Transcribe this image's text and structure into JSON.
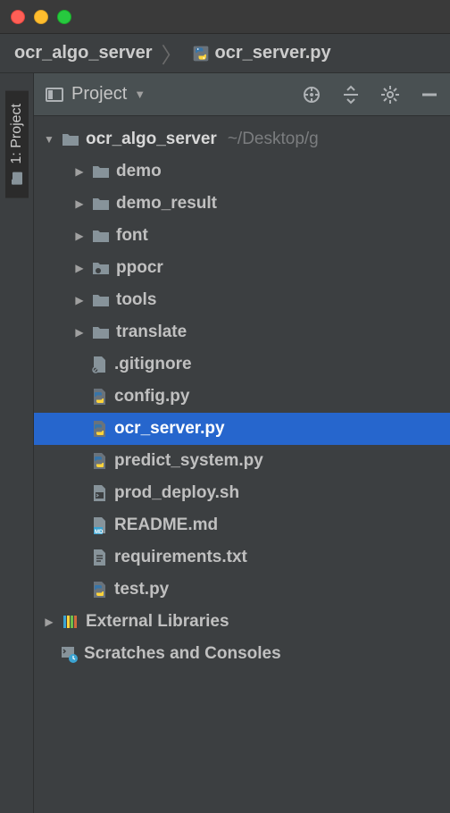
{
  "breadcrumb": {
    "root": "ocr_algo_server",
    "file": "ocr_server.py"
  },
  "rail": {
    "project_tab": "1: Project"
  },
  "panel": {
    "title_icon": "project-view-icon",
    "title": "Project",
    "icons": {
      "target": "select-opened-file",
      "collapse": "expand-all",
      "settings": "settings",
      "hide": "hide"
    }
  },
  "tree": {
    "root": {
      "name": "ocr_algo_server",
      "path_hint": "~/Desktop/g",
      "children": [
        {
          "type": "folder",
          "name": "demo"
        },
        {
          "type": "folder",
          "name": "demo_result"
        },
        {
          "type": "folder",
          "name": "font"
        },
        {
          "type": "folder_marked",
          "name": "ppocr"
        },
        {
          "type": "folder",
          "name": "tools"
        },
        {
          "type": "folder",
          "name": "translate"
        },
        {
          "type": "gitignore",
          "name": ".gitignore"
        },
        {
          "type": "python",
          "name": "config.py"
        },
        {
          "type": "python",
          "name": "ocr_server.py",
          "selected": true
        },
        {
          "type": "python",
          "name": "predict_system.py"
        },
        {
          "type": "shell",
          "name": "prod_deploy.sh"
        },
        {
          "type": "markdown",
          "name": "README.md"
        },
        {
          "type": "text",
          "name": "requirements.txt"
        },
        {
          "type": "python",
          "name": "test.py"
        }
      ]
    },
    "external_libraries": "External Libraries",
    "scratches": "Scratches and Consoles"
  }
}
